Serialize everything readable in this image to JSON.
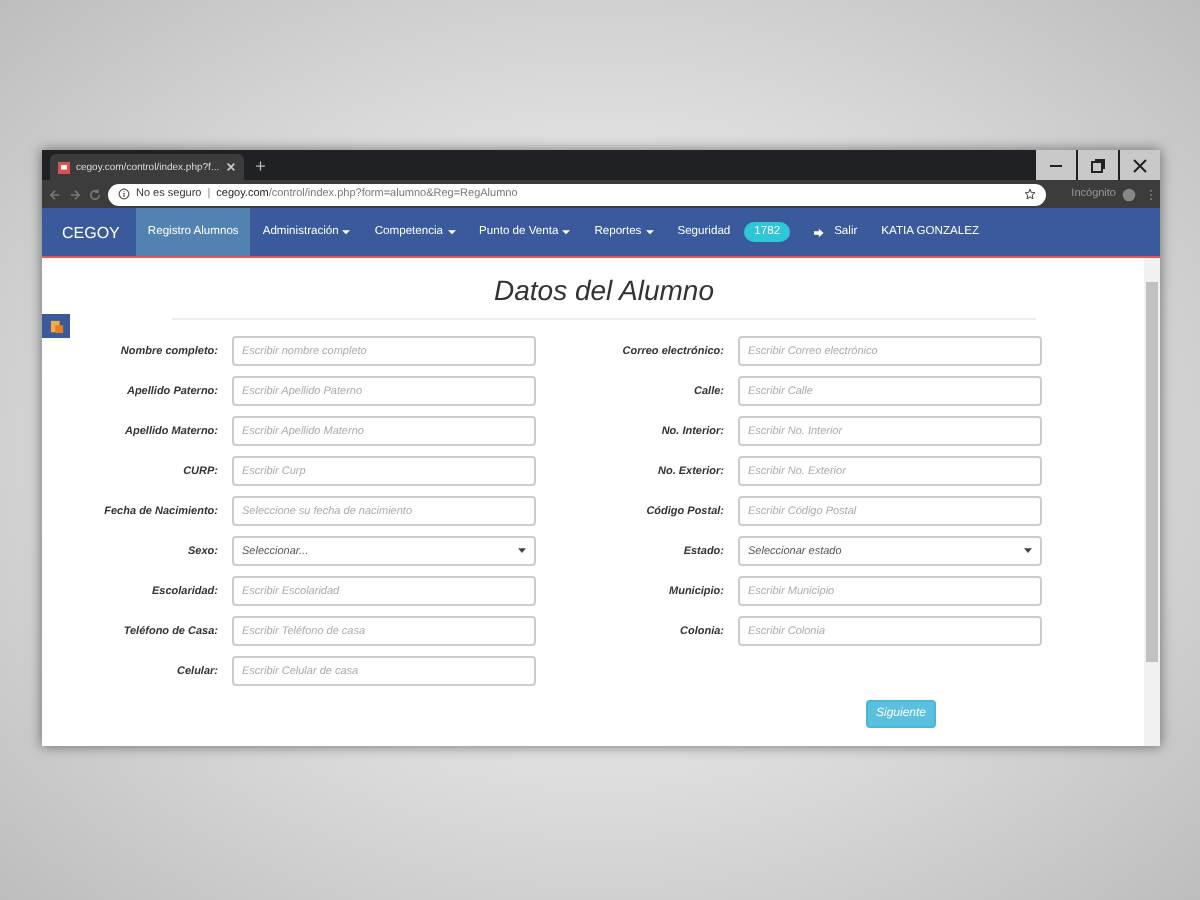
{
  "browser": {
    "tab_title": "cegoy.com/control/index.php?f...",
    "new_tab": "+",
    "security": "No es seguro",
    "separator": "|",
    "url_domain": "cegoy.com",
    "url_path": "/control/index.php?form=alumno&Reg=RegAlumno",
    "incognito": "Incógnito"
  },
  "navbar": {
    "brand": "CEGOY",
    "items": [
      {
        "label": "Registro Alumnos",
        "selected": true,
        "dropdown": false
      },
      {
        "label": "Administración",
        "selected": false,
        "dropdown": true
      },
      {
        "label": "Competencia",
        "selected": false,
        "dropdown": true
      },
      {
        "label": "Punto de Venta",
        "selected": false,
        "dropdown": true
      },
      {
        "label": "Reportes",
        "selected": false,
        "dropdown": true
      },
      {
        "label": "Seguridad",
        "selected": false,
        "dropdown": false,
        "badge": "1782"
      }
    ],
    "logout": "Salir",
    "user": "KATIA GONZALEZ"
  },
  "form": {
    "title": "Datos del Alumno",
    "left": [
      {
        "label": "Nombre completo:",
        "kind": "text",
        "placeholder": "Escribir nombre completo"
      },
      {
        "label": "Apellido Paterno:",
        "kind": "text",
        "placeholder": "Escribir Apellido Paterno"
      },
      {
        "label": "Apellido Materno:",
        "kind": "text",
        "placeholder": "Escribir Apellido Materno"
      },
      {
        "label": "CURP:",
        "kind": "text",
        "placeholder": "Escribir Curp"
      },
      {
        "label": "Fecha de Nacimiento:",
        "kind": "text",
        "placeholder": "Seleccione su fecha de nacimiento"
      },
      {
        "label": "Sexo:",
        "kind": "select",
        "value": "Seleccionar..."
      },
      {
        "label": "Escolaridad:",
        "kind": "text",
        "placeholder": "Escribir Escolaridad"
      },
      {
        "label": "Teléfono de Casa:",
        "kind": "text",
        "placeholder": "Escribir Teléfono de casa"
      },
      {
        "label": "Celular:",
        "kind": "text",
        "placeholder": "Escribir Celular de casa"
      }
    ],
    "right": [
      {
        "label": "Correo electrónico:",
        "kind": "text",
        "placeholder": "Escribir Correo electrónico"
      },
      {
        "label": "Calle:",
        "kind": "text",
        "placeholder": "Escribir Calle"
      },
      {
        "label": "No. Interior:",
        "kind": "text",
        "placeholder": "Escribir No. Interior"
      },
      {
        "label": "No. Exterior:",
        "kind": "text",
        "placeholder": "Escribir No. Exterior"
      },
      {
        "label": "Código Postal:",
        "kind": "text",
        "placeholder": "Escribir Código Postal"
      },
      {
        "label": "Estado:",
        "kind": "select",
        "value": "Seleccionar estado"
      },
      {
        "label": "Municipio:",
        "kind": "text",
        "placeholder": "Escribir Municipio"
      },
      {
        "label": "Colonia:",
        "kind": "text",
        "placeholder": "Escribir Colonia"
      }
    ],
    "submit": "Siguiente"
  }
}
